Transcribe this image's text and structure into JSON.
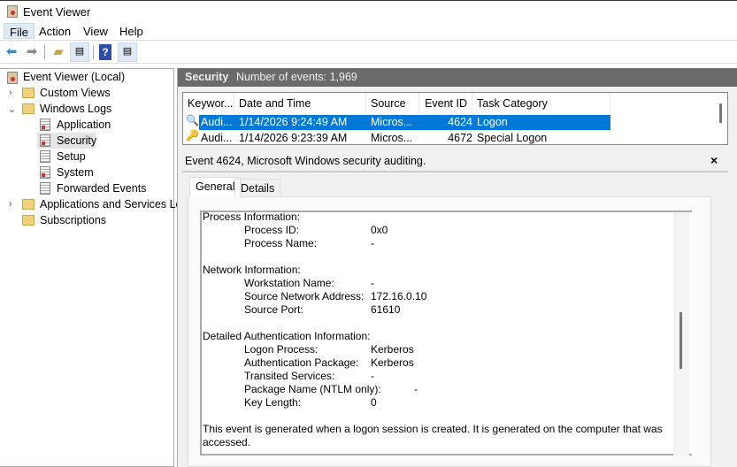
{
  "window": {
    "title": "Event Viewer"
  },
  "menu": [
    "File",
    "Action",
    "View",
    "Help"
  ],
  "toolbar": [
    "back-arrow",
    "forward-arrow",
    "up-folder",
    "show-hide-console-tree",
    "help",
    "show-hide-action-pane"
  ],
  "tree": {
    "root": "Event Viewer (Local)",
    "custom_views": "Custom Views",
    "windows_logs": "Windows Logs",
    "logs": [
      "Application",
      "Security",
      "Setup",
      "System",
      "Forwarded Events"
    ],
    "apps_services": "Applications and Services Lo",
    "subscriptions": "Subscriptions"
  },
  "header": {
    "log": "Security",
    "count": "Number of events: 1,969"
  },
  "list": {
    "columns": [
      "Keywor...",
      "Date and Time",
      "Source",
      "Event ID",
      "Task Category"
    ],
    "rows": [
      {
        "keyword": "Audi...",
        "date": "1/14/2026 9:24:49 AM",
        "source": "Micros...",
        "id": "4624",
        "task": "Logon",
        "selected": true
      },
      {
        "keyword": "Audi...",
        "date": "1/14/2026 9:23:39 AM",
        "source": "Micros...",
        "id": "4672",
        "task": "Special Logon",
        "selected": false
      }
    ]
  },
  "detail": {
    "title": "Event 4624, Microsoft Windows security auditing.",
    "close": "×",
    "tabs": [
      "General",
      "Details"
    ],
    "lines": [
      {
        "h": "Process Information:"
      },
      {
        "l": "Process ID:",
        "v": "0x0"
      },
      {
        "l": "Process Name:",
        "v": "-"
      },
      {},
      {
        "h": "Network Information:"
      },
      {
        "l": "Workstation Name:",
        "v": "-"
      },
      {
        "l": "Source Network Address:",
        "v": "172.16.0.10"
      },
      {
        "l": "Source Port:",
        "v": "61610"
      },
      {},
      {
        "h": "Detailed Authentication Information:"
      },
      {
        "l": "Logon Process:",
        "v": "Kerberos"
      },
      {
        "l": "Authentication Package:",
        "v": "Kerberos"
      },
      {
        "l": "Transited Services:",
        "v": "-"
      },
      {
        "l": "Package Name (NTLM only):",
        "v": "-",
        "wide": true
      },
      {
        "l": "Key Length:",
        "v": "0"
      },
      {},
      {
        "h": "This event is generated when a logon session is created. It is generated on the computer that was"
      },
      {
        "h": "accessed."
      }
    ]
  },
  "colors": {
    "selection": "#0078d7",
    "header_bar": "#6b6b6b"
  }
}
